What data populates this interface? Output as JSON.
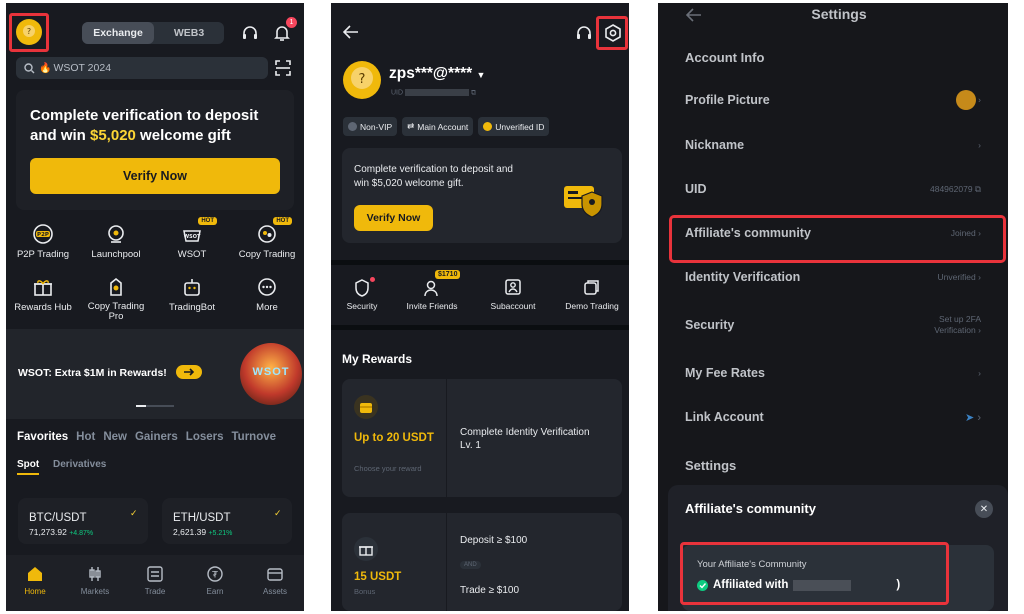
{
  "panel1": {
    "tabs": [
      "Exchange",
      "WEB3"
    ],
    "notif_count": "1",
    "search_placeholder": "WSOT 2024",
    "promo": {
      "title_line1": "Complete verification to deposit",
      "title_line2_pre": "and win ",
      "title_amount": "$5,020",
      "title_line2_post": " welcome gift",
      "button": "Verify Now"
    },
    "grid_row1": [
      {
        "label": "P2P Trading",
        "icon": "p2p-icon",
        "hot": ""
      },
      {
        "label": "Launchpool",
        "icon": "launchpool-icon",
        "hot": ""
      },
      {
        "label": "WSOT",
        "icon": "wsot-icon",
        "hot": "HOT"
      },
      {
        "label": "Copy Trading",
        "icon": "copy-trading-icon",
        "hot": "HOT"
      }
    ],
    "grid_row2": [
      {
        "label": "Rewards Hub",
        "icon": "gift-icon"
      },
      {
        "label": "Copy Trading Pro",
        "icon": "copy-pro-icon"
      },
      {
        "label": "TradingBot",
        "icon": "bot-icon"
      },
      {
        "label": "More",
        "icon": "more-icon"
      }
    ],
    "banner": {
      "text": "WSOT: Extra $1M in Rewards!",
      "badge": "WSOT"
    },
    "market_tabs": [
      "Favorites",
      "Hot",
      "New",
      "Gainers",
      "Losers",
      "Turnove"
    ],
    "sub_tabs": [
      "Spot",
      "Derivatives"
    ],
    "pairs": [
      {
        "pair": "BTC/USDT",
        "price": "71,273.92",
        "change": "+4.87%"
      },
      {
        "pair": "ETH/USDT",
        "price": "2,621.39",
        "change": "+5.21%"
      }
    ],
    "nav": [
      "Home",
      "Markets",
      "Trade",
      "Earn",
      "Assets"
    ]
  },
  "panel2": {
    "username": "zps***@****",
    "uid_label": "UID",
    "badges": [
      "Non-VIP",
      "Main Account",
      "Unverified ID"
    ],
    "promo_text_1": "Complete verification to deposit and",
    "promo_text_2": "win $5,020 welcome gift.",
    "verify_button": "Verify Now",
    "actions": [
      {
        "label": "Security",
        "icon": "shield-icon",
        "tag": ""
      },
      {
        "label": "Invite Friends",
        "icon": "invite-icon",
        "tag": "$1710"
      },
      {
        "label": "Subaccount",
        "icon": "subaccount-icon",
        "tag": ""
      },
      {
        "label": "Demo Trading",
        "icon": "demo-icon",
        "tag": ""
      }
    ],
    "rewards_title": "My Rewards",
    "reward1": {
      "amount": "Up to 20 USDT",
      "sub": "Choose your reward",
      "task": "Complete Identity Verification Lv. 1"
    },
    "reward2": {
      "amount": "15 USDT",
      "sub": "Bonus",
      "task1": "Deposit ≥ $100",
      "and": "AND",
      "task2": "Trade ≥ $100"
    }
  },
  "panel3": {
    "title": "Settings",
    "section1": "Account Info",
    "rows": [
      {
        "label": "Profile Picture",
        "value": ""
      },
      {
        "label": "Nickname",
        "value": ""
      },
      {
        "label": "UID",
        "value": "484962079"
      },
      {
        "label": "Affiliate's community",
        "value": "Joined"
      },
      {
        "label": "Identity Verification",
        "value": "Unverified"
      },
      {
        "label": "Security",
        "value": "Set up 2FA Verification"
      },
      {
        "label": "My Fee Rates",
        "value": ""
      },
      {
        "label": "Link Account",
        "value": ""
      }
    ],
    "section2": "Settings",
    "sheet": {
      "title": "Affiliate's community",
      "box_label": "Your Affiliate's Community",
      "box_value": "Affiliated with",
      "box_tail": ")"
    }
  },
  "colors": {
    "accent": "#f0b90b",
    "bg": "#181a20",
    "green": "#0ecb81",
    "highlight": "#e8333b"
  }
}
